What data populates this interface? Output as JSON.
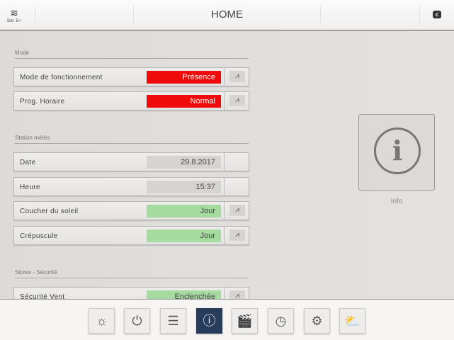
{
  "header": {
    "building": "Bat. B+",
    "title": "HOME",
    "corner_button": "c"
  },
  "sections": [
    {
      "title": "Mode"
    },
    {
      "title": "Station météo"
    },
    {
      "title": "Stores - Sécurité"
    }
  ],
  "rows": [
    {
      "label": "Mode de fonctionnement",
      "value": "Présence",
      "chart": "⩘"
    },
    {
      "label": "Prog. Horaire",
      "value": "Normal",
      "chart": "⩘"
    },
    {
      "label": "Date",
      "value": "29.8.2017"
    },
    {
      "label": "Heure",
      "value": "15:37"
    },
    {
      "label": "Coucher du soleil",
      "value": "Jour",
      "chart": "⩘"
    },
    {
      "label": "Crépuscule",
      "value": "Jour",
      "chart": "⩘"
    },
    {
      "label": "Sécurité Vent",
      "value": "Enclenchée",
      "chart": "⩘"
    }
  ],
  "info_panel": {
    "icon": "i",
    "label": "Info"
  },
  "nav": [
    {
      "name": "lighting",
      "glyph": "☼"
    },
    {
      "name": "power",
      "glyph": "⏻"
    },
    {
      "name": "blinds",
      "glyph": "☰"
    },
    {
      "name": "info",
      "glyph": "ⓘ"
    },
    {
      "name": "scenes",
      "glyph": "🎬"
    },
    {
      "name": "clock",
      "glyph": "◷"
    },
    {
      "name": "settings",
      "glyph": "⚙"
    },
    {
      "name": "weather",
      "glyph": "⛅"
    }
  ],
  "colors": {
    "red": "#f10a0a",
    "green": "#a6dba0",
    "active_nav": "#283c5c"
  }
}
